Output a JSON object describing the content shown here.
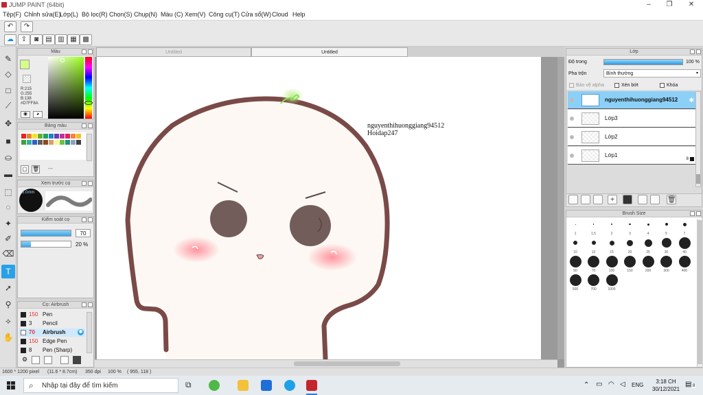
{
  "title": "JUMP PAINT (64bit)",
  "menu": [
    "Tệp(F)",
    "Chỉnh sửa(E)",
    "Lớp(L)",
    "Bộ lọc(R)",
    "Chọn(S)",
    "Chụp(N)",
    "Màu (C)",
    "Xem(V)",
    "Công cụ(T)",
    "Cửa sổ(W)",
    "Cloud",
    "Help"
  ],
  "tabs": [
    "Untitled",
    "Untitled"
  ],
  "color_panel": {
    "title": "Màu",
    "r": "R:215",
    "g": "G:255",
    "b": "B:138",
    "hex": "#D7FF8A",
    "current": "#d7ff8a"
  },
  "swatch_panel": {
    "title": "Bảng màu",
    "dash": "---"
  },
  "preview_panel": {
    "title": "Xem trước cọ",
    "size": "5.0mm"
  },
  "control_panel": {
    "title": "Kiểm soát cọ",
    "size_val": "70",
    "opacity_val": "20 %"
  },
  "brush_panel": {
    "title": "Cọ: Airbrush",
    "items": [
      {
        "num": "150",
        "label": "Pen"
      },
      {
        "num": "3",
        "label": "Pencil"
      },
      {
        "num": "70",
        "label": "Airbrush"
      },
      {
        "num": "150",
        "label": "Edge Pen"
      },
      {
        "num": "8",
        "label": "Pen (Sharp)"
      }
    ]
  },
  "canvas": {
    "text1": "nguyenthihuonggiang94512",
    "text2": "Hoidap247"
  },
  "layer_panel": {
    "title": "Lớp",
    "opacity_label": "Độ trong",
    "opacity_val": "100 %",
    "blend_label": "Pha trộn",
    "blend_val": "Bình thường",
    "protect_alpha": "Bảo vệ alpha",
    "clip": "Xén bớt",
    "lock": "Khóa",
    "layers": [
      "nguyenthihuonggiang94512",
      "Lớp3",
      "Lớp2",
      "Lớp1"
    ],
    "count": "8"
  },
  "brush_size": {
    "title": "Brush Size",
    "sizes": [
      "1",
      "1.5",
      "2",
      "3",
      "4",
      "5",
      "7",
      "10",
      "12",
      "15",
      "20",
      "25",
      "30",
      "40",
      "50",
      "70",
      "100",
      "150",
      "200",
      "300",
      "400",
      "500",
      "700",
      "1000"
    ]
  },
  "status": {
    "size": "1600 * 1200 pixel",
    "cm": "(11.6 * 8.7cm)",
    "dpi": "350 dpi",
    "zoom": "100 %",
    "coords": "( 955, 118 )"
  },
  "taskbar": {
    "search": "Nhập tại đây để tìm kiếm",
    "lang": "ENG",
    "time": "3:18 CH",
    "date": "30/12/2021",
    "notif": "8"
  }
}
